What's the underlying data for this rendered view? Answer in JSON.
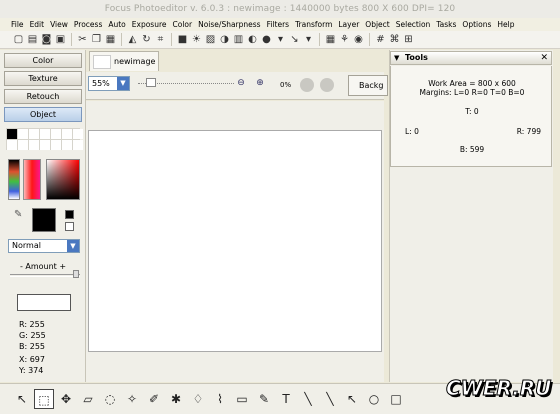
{
  "window": {
    "title": "Focus Photoeditor v. 6.0.3 : newimage : 1440000 bytes   800 X 600 DPI= 120"
  },
  "menu": [
    "File",
    "Edit",
    "View",
    "Process",
    "Auto",
    "Exposure",
    "Color",
    "Noise/Sharpness",
    "Filters",
    "Transform",
    "Layer",
    "Object",
    "Selection",
    "Tasks",
    "Options",
    "Help"
  ],
  "toolbar_icons": [
    "new-icon",
    "open-icon",
    "save-icon",
    "print-icon",
    "scan-icon",
    "cut-icon",
    "copy-icon",
    "paste-icon",
    "flip-icon",
    "rotate-icon",
    "crop-icon",
    "levels-icon",
    "brightness-icon",
    "image-icon",
    "contrast-icon",
    "histogram-icon",
    "color-balance-icon",
    "effects-icon",
    "tool-select-icon",
    "dropdown-icon",
    "stamp-icon",
    "batch-icon",
    "color-wheel-icon",
    "grid-icon",
    "transform-icon",
    "pattern-icon"
  ],
  "left_panel": {
    "tabs": [
      "Color",
      "Texture",
      "Retouch",
      "Object"
    ],
    "active_tab": "Object",
    "blend_mode": "Normal",
    "amount_label": "- Amount +",
    "readout": {
      "r": "R: 255",
      "g": "G: 255",
      "b": "B: 255",
      "x": "X: 697",
      "y": "Y: 374"
    }
  },
  "document": {
    "tab_label": "newimage",
    "zoom": "55%",
    "percent": "0%",
    "back_button": "Backg"
  },
  "tools_panel": {
    "title": "Tools",
    "work_area": "Work Area = 800 x 600",
    "margins": "Margins: L=0 R=0 T=0 B=0",
    "top": "T: 0",
    "left": "L: 0",
    "right": "R: 799",
    "bottom": "B: 599"
  },
  "bottom_tools": [
    "pointer-icon",
    "select-icon",
    "move-icon",
    "eraser-icon",
    "lasso-icon",
    "magic-wand-icon",
    "brush-icon",
    "clone-icon",
    "freeform-icon",
    "smudge-icon",
    "rect-select-icon",
    "dropper-icon",
    "text-icon",
    "line-icon",
    "line2-icon",
    "arrow-icon",
    "circle-icon",
    "rect-icon"
  ],
  "watermark": "CWER.RU"
}
